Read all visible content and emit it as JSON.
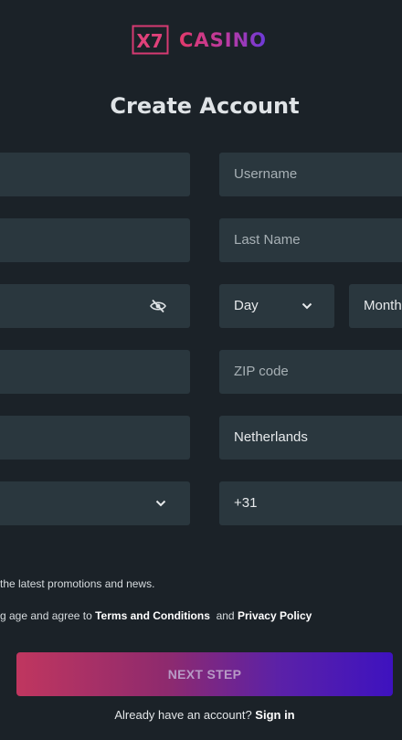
{
  "brand": {
    "logo_mark": "X7",
    "logo_word": "CASINO"
  },
  "page": {
    "title": "Create Account"
  },
  "form": {
    "username": {
      "placeholder": "Username"
    },
    "last_name": {
      "placeholder": "Last Name"
    },
    "birth_day": {
      "placeholder": "Day"
    },
    "birth_month": {
      "placeholder": "Month"
    },
    "zip_code": {
      "placeholder": "ZIP code"
    },
    "country": {
      "value": "Netherlands"
    },
    "phone_code": {
      "value": "+31"
    }
  },
  "consents": {
    "promo_text": "the latest promotions and news.",
    "terms_prefix": "g age and agree to",
    "terms_link": "Terms and Conditions",
    "terms_and": "and",
    "privacy_link": "Privacy Policy"
  },
  "actions": {
    "next_step": "NEXT STEP",
    "signin_prompt": "Already have an account?",
    "signin_link": "Sign in"
  },
  "icons": {
    "password_toggle": "eye-slash-icon",
    "dropdown": "chevron-down-icon"
  },
  "colors": {
    "background": "#1b2228",
    "field": "#2a373e",
    "accent_start": "#c0365f",
    "accent_end": "#3e12bf"
  }
}
